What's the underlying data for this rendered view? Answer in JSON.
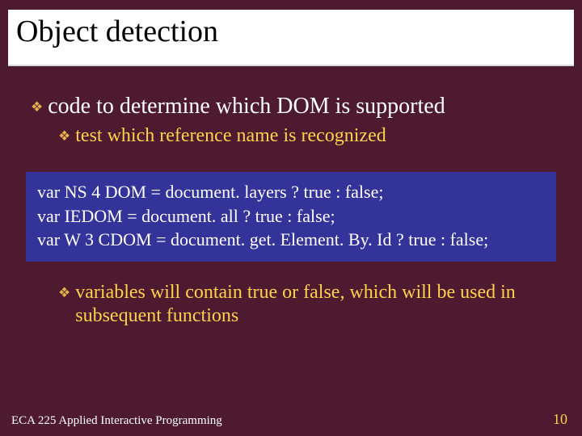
{
  "title": "Object detection",
  "bullets": {
    "lvl1": "code to determine which DOM is supported",
    "lvl2a": "test which reference name is recognized",
    "lvl2b": "variables will contain true or false, which will be used in subsequent functions"
  },
  "code": {
    "l1": "var NS 4 DOM = document. layers ? true : false;",
    "l2": "var IEDOM = document. all ? true : false;",
    "l3": "var W 3 CDOM = document. get. Element. By. Id ? true : false;"
  },
  "footer": {
    "course": "ECA 225   Applied Interactive Programming",
    "page": "10"
  },
  "glyph": {
    "diamond": "❖"
  }
}
